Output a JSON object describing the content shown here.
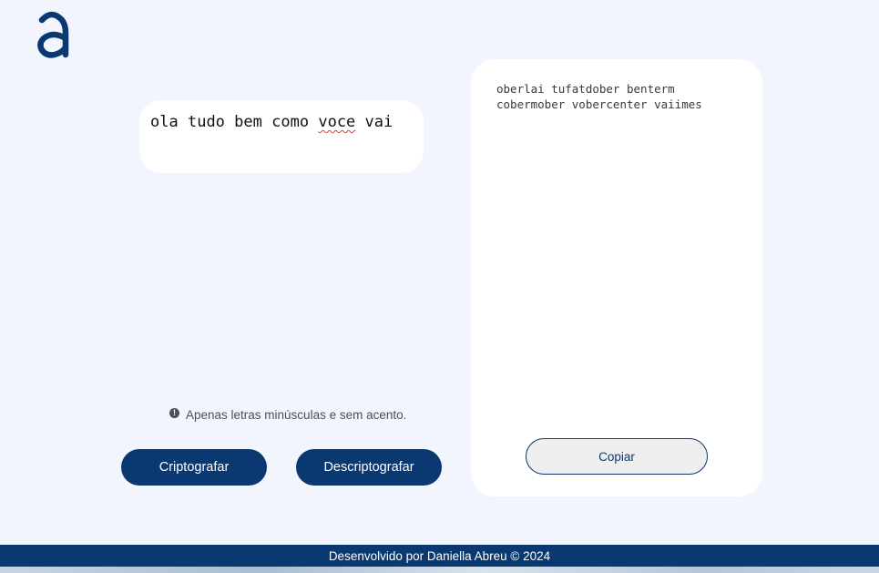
{
  "logo": {
    "icon": "alura-a-logo",
    "color": "#0a3871"
  },
  "input": {
    "words": [
      "ola",
      "tudo",
      "bem",
      "como",
      "voce",
      "vai"
    ],
    "misspelled": "voce"
  },
  "hint": {
    "icon": "exclamation-circle-icon",
    "text": "Apenas letras minúsculas e sem acento."
  },
  "buttons": {
    "encrypt_label": "Criptografar",
    "decrypt_label": "Descriptografar"
  },
  "output": {
    "text": "oberlai tufatdober benterm cobermober vobercenter vaiimes",
    "copy_label": "Copiar"
  },
  "footer": {
    "text": "Desenvolvido por Daniella Abreu © 2024"
  },
  "colors": {
    "primary": "#0a3871",
    "background": "#f2f5fd",
    "panel": "#ffffff"
  }
}
